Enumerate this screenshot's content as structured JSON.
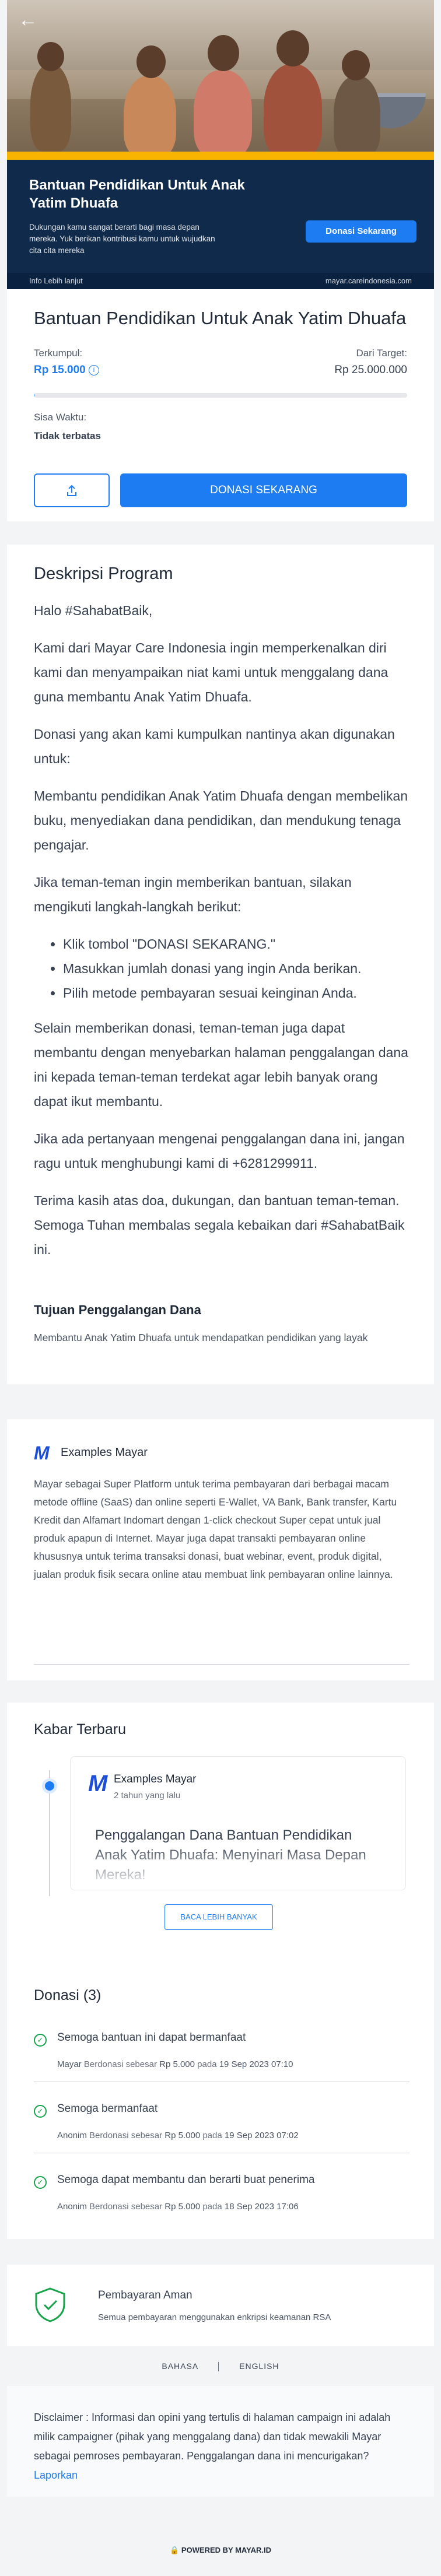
{
  "hero": {
    "title": "Bantuan Pendidikan Untuk Anak Yatim Dhuafa",
    "subtitle": "Dukungan kamu sangat berarti bagi masa depan mereka. Yuk berikan kontribusi kamu untuk wujudkan cita cita mereka",
    "cta": "Donasi Sekarang",
    "info_link": "Info Lebih lanjut",
    "domain": "mayar.careindonesia.com"
  },
  "campaign": {
    "title": "Bantuan Pendidikan Untuk Anak Yatim Dhuafa",
    "collected_label": "Terkumpul:",
    "collected_value": "Rp 15.000",
    "target_label": "Dari Target:",
    "target_value": "Rp 25.000.000",
    "progress_fraction": 0.0006,
    "time_label": "Sisa Waktu:",
    "time_value": "Tidak terbatas",
    "donate_button": "DONASI SEKARANG"
  },
  "description": {
    "heading": "Deskripsi Program",
    "greeting": "Halo #SahabatBaik,",
    "p1": "Kami dari Mayar Care Indonesia ingin memperkenalkan diri kami dan menyampaikan niat kami untuk menggalang dana guna membantu Anak Yatim Dhuafa.",
    "p2": "Donasi yang akan kami kumpulkan nantinya akan digunakan untuk:",
    "p3": "Membantu pendidikan Anak Yatim Dhuafa dengan membelikan buku, menyediakan dana pendidikan, dan mendukung tenaga pengajar.",
    "p4": "Jika teman-teman ingin memberikan bantuan, silakan mengikuti langkah-langkah berikut:",
    "steps": [
      "Klik tombol \"DONASI SEKARANG.\"",
      "Masukkan jumlah donasi yang ingin Anda berikan.",
      "Pilih metode pembayaran sesuai keinginan Anda."
    ],
    "p5": "Selain memberikan donasi, teman-teman juga dapat membantu dengan menyebarkan halaman penggalangan dana ini kepada teman-teman terdekat agar lebih banyak orang dapat ikut membantu.",
    "p6": "Jika ada pertanyaan mengenai penggalangan dana ini, jangan ragu untuk menghubungi kami di +6281299911.",
    "p7": "Terima kasih atas doa, dukungan, dan bantuan teman-teman. Semoga Tuhan membalas segala kebaikan dari #SahabatBaik ini.",
    "goal_title": "Tujuan Penggalangan Dana",
    "goal_text": "Membantu Anak Yatim Dhuafa untuk mendapatkan pendidikan yang layak"
  },
  "organizer": {
    "name": "Examples Mayar",
    "about": "Mayar sebagai Super Platform untuk terima pembayaran dari berbagai macam metode offline (SaaS) dan online seperti E-Wallet, VA Bank, Bank transfer, Kartu Kredit dan Alfamart Indomart dengan 1-click checkout Super cepat untuk jual produk apapun di Internet. Mayar juga dapat transakti pembayaran online khususnya untuk terima transaksi donasi, buat webinar, event, produk digital, jualan produk fisik secara online atau membuat link pembayaran online lainnya."
  },
  "news": {
    "heading": "Kabar Terbaru",
    "author": "Examples Mayar",
    "time": "2 tahun yang lalu",
    "title": "Penggalangan Dana Bantuan Pendidikan Anak Yatim Dhuafa: Menyinari Masa Depan Mereka!",
    "more_button": "BACA LEBIH BANYAK"
  },
  "donations": {
    "heading": "Donasi (3)",
    "items": [
      {
        "message": "Semoga bantuan ini dapat bermanfaat",
        "donor": "Mayar",
        "mid": "Berdonasi sebesar",
        "amount": "Rp 5.000",
        "date_prefix": "pada",
        "date": "19 Sep 2023 07:10"
      },
      {
        "message": "Semoga bermanfaat",
        "donor": "Anonim",
        "mid": "Berdonasi sebesar",
        "amount": "Rp 5.000",
        "date_prefix": "pada",
        "date": "19 Sep 2023 07:02"
      },
      {
        "message": "Semoga dapat membantu dan berarti buat penerima",
        "donor": "Anonim",
        "mid": "Berdonasi sebesar",
        "amount": "Rp 5.000",
        "date_prefix": "pada",
        "date": "18 Sep 2023 17:06"
      }
    ]
  },
  "secure": {
    "title": "Pembayaran Aman",
    "desc": "Semua pembayaran menggunakan enkripsi keamanan RSA"
  },
  "language": {
    "bahasa": "BAHASA",
    "english": "ENGLISH"
  },
  "disclaimer": {
    "text": "Disclaimer : Informasi dan opini yang tertulis di halaman campaign ini adalah milik campaigner (pihak yang menggalang dana) dan tidak mewakili Mayar sebagai pemroses pembayaran. Penggalangan dana ini mencurigakan?",
    "link": "Laporkan"
  },
  "footer": {
    "powered": "POWERED BY MAYAR.ID"
  },
  "colors": {
    "accent": "#1d7cf2",
    "banner": "#0f2a4a",
    "stripe": "#f8b400",
    "success": "#16a34a"
  }
}
